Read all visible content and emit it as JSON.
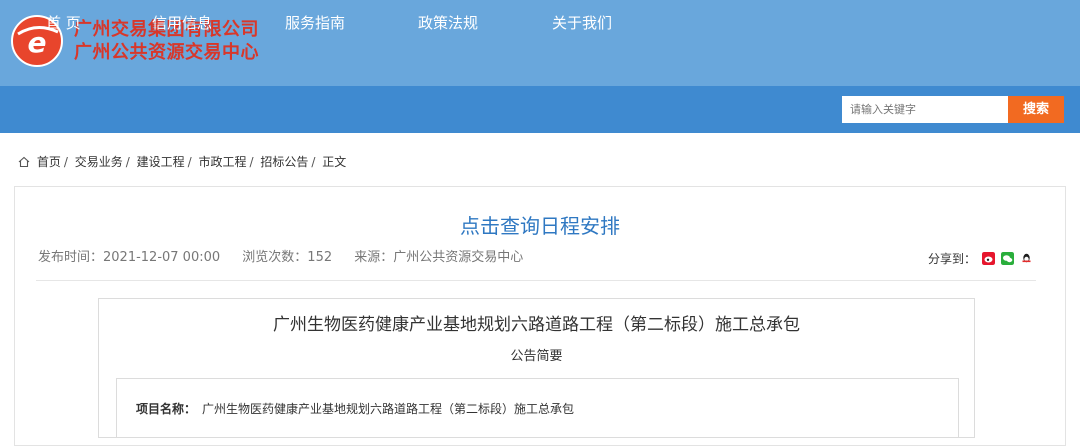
{
  "header": {
    "brand_line1": "广州交易集团有限公司",
    "brand_line2": "广州公共资源交易中心",
    "logo_icon": "e-logo-icon",
    "colors": {
      "header_bg": "#69a7dc",
      "nav_bg": "#3f8ad0",
      "brand_text": "#d8372a",
      "search_button": "#f26a21"
    }
  },
  "nav": {
    "items": [
      {
        "label": "首 页"
      },
      {
        "label": "信用信息"
      },
      {
        "label": "服务指南"
      },
      {
        "label": "政策法规"
      },
      {
        "label": "关于我们"
      }
    ]
  },
  "search": {
    "placeholder": "请输入关键字",
    "button_label": "搜索"
  },
  "breadcrumb": {
    "icon": "home-icon",
    "items": [
      "首页",
      "交易业务",
      "建设工程",
      "市政工程",
      "招标公告",
      "正文"
    ]
  },
  "article": {
    "title": "点击查询日程安排",
    "publish_time": "发布时间：2021-12-07 00:00",
    "views": "浏览次数：152",
    "source": "来源：广州公共资源交易中心",
    "share_label": "分享到：",
    "share_icons": [
      "weibo-icon",
      "wechat-icon",
      "qq-icon"
    ]
  },
  "notice": {
    "title": "广州生物医药健康产业基地规划六路道路工程（第二标段）施工总承包",
    "subtitle": "公告简要",
    "project_label": "项目名称：",
    "project_value": "广州生物医药健康产业基地规划六路道路工程（第二标段）施工总承包"
  }
}
